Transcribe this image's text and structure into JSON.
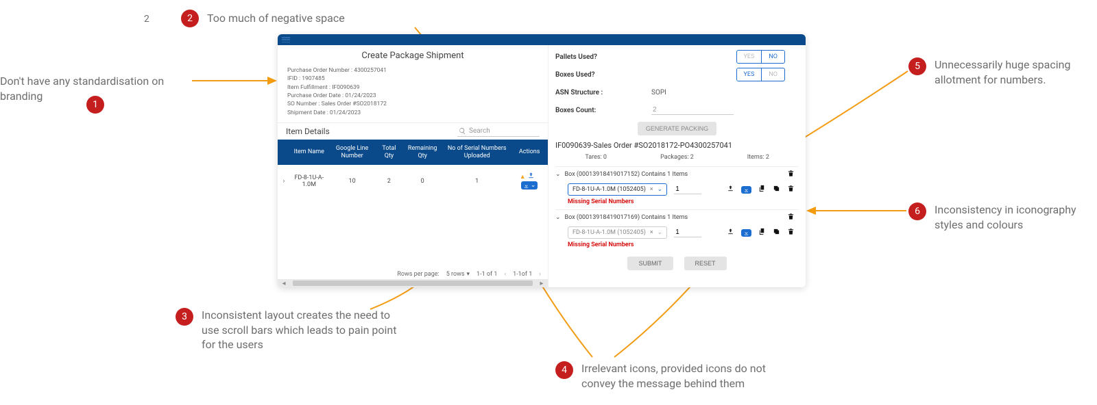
{
  "annotations": {
    "n1_text": "Don't have any standardisation on branding",
    "n2_text": "Too much of negative space",
    "n3_text": "Inconsistent layout creates the need to use scroll bars which leads to pain point for the users",
    "n4_text": "Irrelevant icons, provided icons do not convey the message behind them",
    "n5_text": "Unnecessarily huge spacing allotment for numbers.",
    "n6_text": "Inconsistency in iconography styles and colours",
    "b1": "1",
    "b2": "2",
    "b3": "3",
    "b4": "4",
    "b5": "5",
    "b6": "6",
    "stray": "2"
  },
  "app": {
    "title": "Create Package Shipment",
    "meta": {
      "po_lbl": "Purchase Order Number :",
      "po_val": "4300257041",
      "ifid_lbl": "IFID :",
      "ifid_val": "1907485",
      "fulfil_lbl": "Item Fulfillment :",
      "fulfil_val": "IF0090639",
      "podate_lbl": "Purchase Order Date :",
      "podate_val": "01/24/2023",
      "so_lbl": "SO Number :",
      "so_val": "Sales Order #SO2018172",
      "ship_lbl": "Shipment Date :",
      "ship_val": "01/24/2023"
    },
    "item_details_title": "Item Details",
    "search_placeholder": "Search",
    "table": {
      "headers": {
        "name": "Item Name",
        "gln": "Google Line Number",
        "total": "Total Qty",
        "remain": "Remaining Qty",
        "serials": "No of Serial Numbers Uploaded",
        "actions": "Actions"
      },
      "row": {
        "name": "FD-8-1U-A-1.0M",
        "gln": "10",
        "total": "2",
        "remain": "0",
        "serials": "1"
      }
    },
    "pager": {
      "rpp_lbl": "Rows per page:",
      "rpp_val": "5 rows",
      "counter1": "1-1 of 1",
      "counter2": "1-1of 1"
    },
    "right": {
      "pallets_lbl": "Pallets Used?",
      "boxes_lbl": "Boxes Used?",
      "asn_lbl": "ASN Structure :",
      "asn_val": "SOPI",
      "count_lbl": "Boxes Count:",
      "count_val": "2",
      "yes": "YES",
      "no": "NO",
      "gen": "GENERATE PACKING",
      "bundle": "IF0090639-Sales Order #SO2018172-PO4300257041",
      "tares": "Tares: 0",
      "packages": "Packages: 2",
      "items": "Items: 2",
      "box1_hdr": "Box (00013918419017152) Contains 1 Items",
      "box2_hdr": "Box (00013918419017169) Contains 1 Items",
      "chip": "FD-8-1U-A-1.0M (1052405)",
      "qty": "1",
      "err": "Missing Serial Numbers",
      "submit": "SUBMIT",
      "reset": "RESET"
    }
  }
}
